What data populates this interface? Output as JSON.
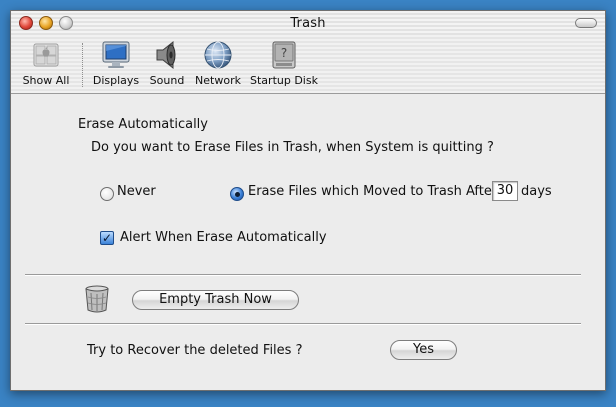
{
  "window": {
    "title": "Trash"
  },
  "toolbar": {
    "items": [
      {
        "label": "Show All",
        "icon": "apple-panes-icon"
      },
      {
        "label": "Displays",
        "icon": "display-icon"
      },
      {
        "label": "Sound",
        "icon": "speaker-icon"
      },
      {
        "label": "Network",
        "icon": "globe-icon"
      },
      {
        "label": "Startup Disk",
        "icon": "hard-disk-icon"
      }
    ]
  },
  "erase": {
    "heading": "Erase Automatically",
    "question": "Do you want to Erase Files in Trash, when System is quitting ?",
    "option_never": "Never",
    "option_after": "Erase Files which Moved to Trash After",
    "days_value": "30",
    "days_unit": "days",
    "selected": "after",
    "alert_label": "Alert When Erase Automatically",
    "alert_checked": true
  },
  "empty": {
    "button_label": "Empty Trash Now",
    "icon": "trash-can-icon"
  },
  "recover": {
    "question": "Try to  Recover the deleted Files ?",
    "button_label": "Yes"
  },
  "colors": {
    "desktop": "#3a83c4",
    "window_bg": "#ececec",
    "accent": "#3a7fd6"
  }
}
